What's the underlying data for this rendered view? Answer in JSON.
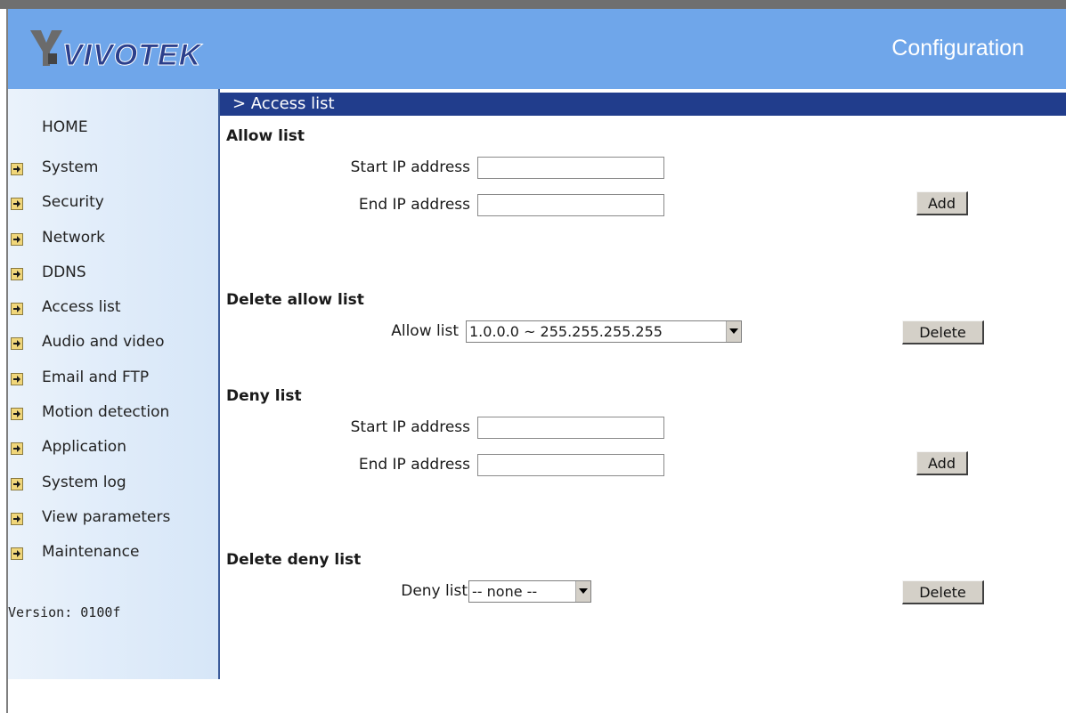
{
  "header": {
    "logo_text": "VIVOTEK",
    "title": "Configuration"
  },
  "sidebar": {
    "home": "HOME",
    "items": [
      {
        "label": "System"
      },
      {
        "label": "Security"
      },
      {
        "label": "Network"
      },
      {
        "label": "DDNS"
      },
      {
        "label": "Access list"
      },
      {
        "label": "Audio and video"
      },
      {
        "label": "Email and FTP"
      },
      {
        "label": "Motion detection"
      },
      {
        "label": "Application"
      },
      {
        "label": "System log"
      },
      {
        "label": "View parameters"
      },
      {
        "label": "Maintenance"
      }
    ],
    "version": "Version: 0100f"
  },
  "section": {
    "title": "> Access list"
  },
  "allow": {
    "heading": "Allow list",
    "start_label": "Start IP address",
    "end_label": "End IP address",
    "start_value": "",
    "end_value": "",
    "add_label": "Add"
  },
  "delete_allow": {
    "heading": "Delete allow list",
    "select_label": "Allow list",
    "selected": "1.0.0.0 ~ 255.255.255.255",
    "delete_label": "Delete"
  },
  "deny": {
    "heading": "Deny list",
    "start_label": "Start IP address",
    "end_label": "End IP address",
    "start_value": "",
    "end_value": "",
    "add_label": "Add"
  },
  "delete_deny": {
    "heading": "Delete deny list",
    "select_label": "Deny list",
    "selected": "-- none --",
    "delete_label": "Delete"
  },
  "colors": {
    "header_bg": "#6fa6ea",
    "section_bar": "#213d8c",
    "sidebar_bg": "#d6e6f8"
  }
}
